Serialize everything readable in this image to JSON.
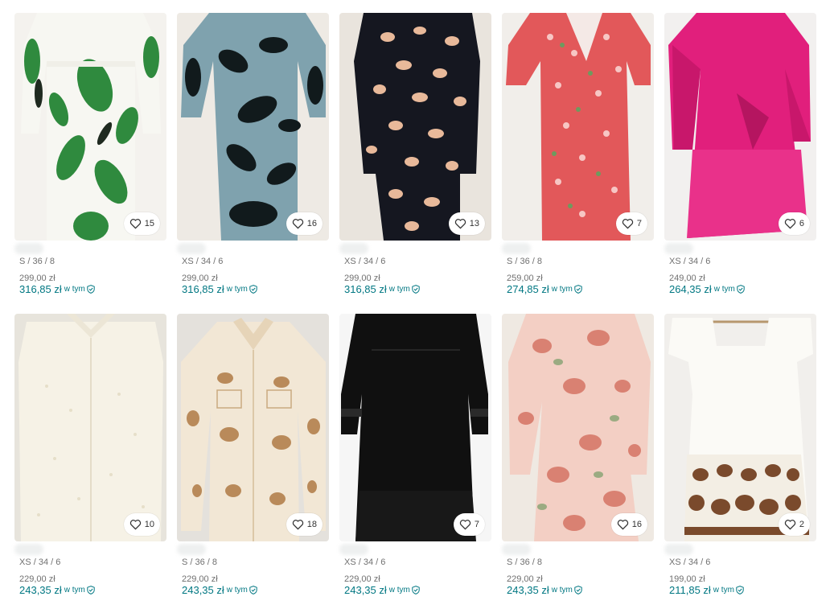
{
  "colors": {
    "accent": "#007782",
    "muted": "#707070"
  },
  "fee_label": "w tym",
  "items": [
    {
      "likes": "15",
      "size": "S / 36 / 8",
      "price": "299,00 zł",
      "total": "316,85 zł"
    },
    {
      "likes": "16",
      "size": "XS / 34 / 6",
      "price": "299,00 zł",
      "total": "316,85 zł"
    },
    {
      "likes": "13",
      "size": "XS / 34 / 6",
      "price": "299,00 zł",
      "total": "316,85 zł"
    },
    {
      "likes": "7",
      "size": "S / 36 / 8",
      "price": "259,00 zł",
      "total": "274,85 zł"
    },
    {
      "likes": "6",
      "size": "XS / 34 / 6",
      "price": "249,00 zł",
      "total": "264,35 zł"
    },
    {
      "likes": "10",
      "size": "XS / 34 / 6",
      "price": "229,00 zł",
      "total": "243,35 zł"
    },
    {
      "likes": "18",
      "size": "S / 36 / 8",
      "price": "229,00 zł",
      "total": "243,35 zł"
    },
    {
      "likes": "7",
      "size": "XS / 34 / 6",
      "price": "229,00 zł",
      "total": "243,35 zł"
    },
    {
      "likes": "16",
      "size": "S / 36 / 8",
      "price": "229,00 zł",
      "total": "243,35 zł"
    },
    {
      "likes": "2",
      "size": "XS / 34 / 6",
      "price": "199,00 zł",
      "total": "211,85 zł"
    }
  ]
}
